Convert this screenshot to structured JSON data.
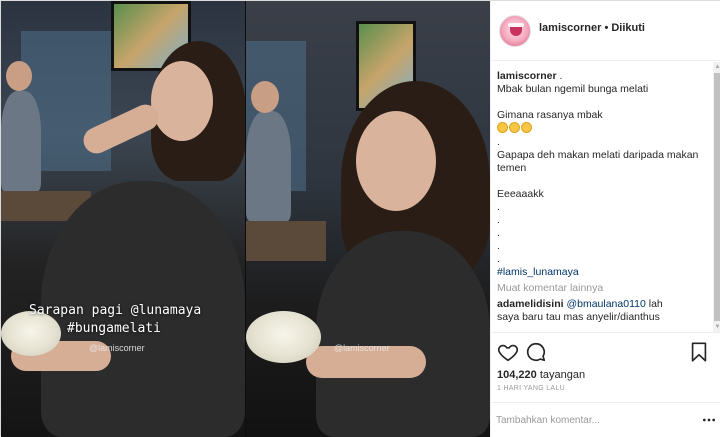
{
  "header": {
    "username": "lamiscorner",
    "separator": "•",
    "follow_status": "Diikuti"
  },
  "caption": {
    "username": "lamiscorner",
    "first_line_suffix": " .",
    "lines": [
      "Mbak bulan ngemil bunga melati",
      "",
      "Gimana rasanya mbak",
      "",
      ".",
      "Gapapa deh makan melati daripada makan",
      "temen",
      "",
      "Eeeaaakk",
      ".",
      ".",
      ".",
      ".",
      "."
    ],
    "hashtag": "#lamis_lunamaya"
  },
  "load_more": "Muat komentar lainnya",
  "comment": {
    "username": "adamelidisini",
    "mention": "@bmaulana0110",
    "text_1": " lah",
    "text_2": "saya baru tau mas anyelir/dianthus"
  },
  "media": {
    "overlay_line1": "Sarapan pagi @lunamaya",
    "overlay_line2": "#bungamelati",
    "watermark": "@lamiscorner"
  },
  "stats": {
    "views_count": "104,220",
    "views_label": "tayangan",
    "date": "1 HARI YANG LALU"
  },
  "add_comment": {
    "placeholder": "Tambahkan komentar..."
  },
  "icons": [
    "heart-icon",
    "comment-icon",
    "bookmark-icon",
    "more-options-icon"
  ],
  "colors": {
    "link": "#003569",
    "muted": "#999999",
    "text": "#262626"
  }
}
